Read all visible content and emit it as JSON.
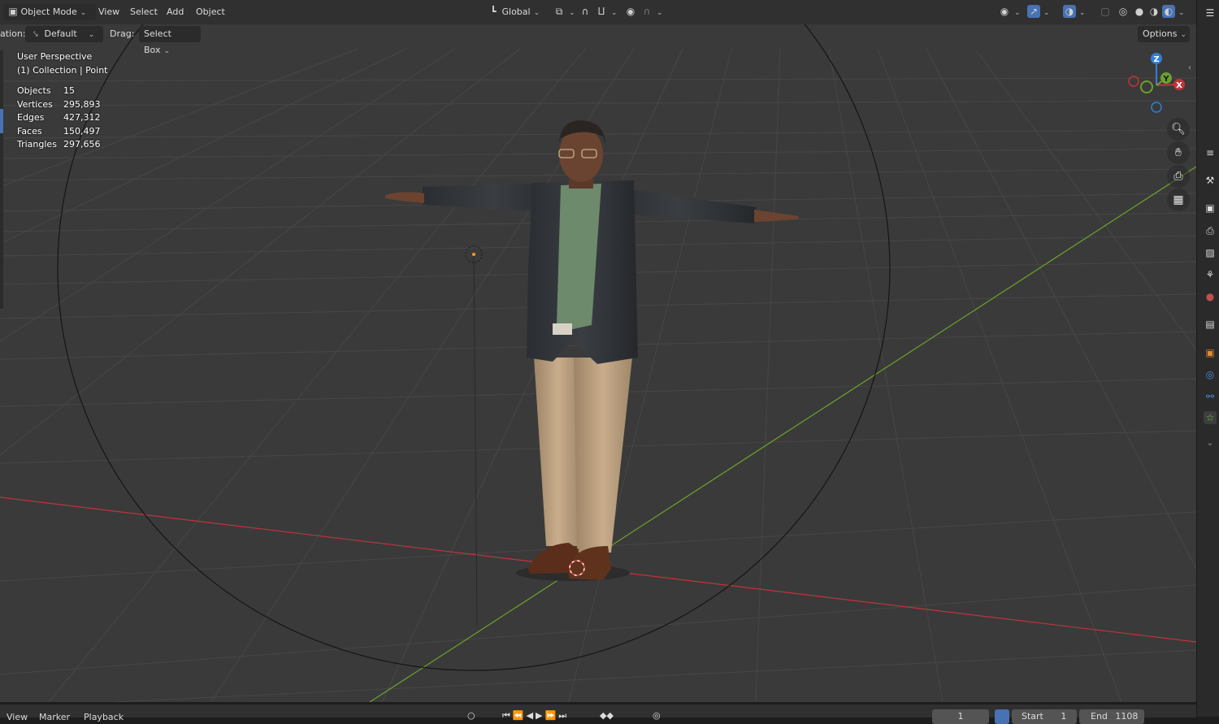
{
  "header": {
    "mode": "Object Mode",
    "menus": [
      "View",
      "Select",
      "Add",
      "Object"
    ],
    "transform_orientation": "Global"
  },
  "toolrow": {
    "orientation_label": "ation:",
    "orientation_value": "Default",
    "drag_label": "Drag:",
    "drag_value": "Select Box",
    "options_label": "Options"
  },
  "viewport": {
    "view_name": "User Perspective",
    "collection": "(1) Collection | Point",
    "stats": [
      {
        "label": "Objects",
        "value": "15"
      },
      {
        "label": "Vertices",
        "value": "295,893"
      },
      {
        "label": "Edges",
        "value": "427,312"
      },
      {
        "label": "Faces",
        "value": "150,497"
      },
      {
        "label": "Triangles",
        "value": "297,656"
      }
    ],
    "gizmo": {
      "x": "X",
      "y": "Y",
      "z": "Z"
    }
  },
  "timeline": {
    "menus": [
      "View",
      "Marker",
      "Playback"
    ],
    "current_frame": "1",
    "start_label": "Start",
    "start_value": "1",
    "end_label": "End",
    "end_value": "1108"
  },
  "colors": {
    "viewport_bg": "#3a3a3a",
    "grid": "#474747",
    "x_axis": "#c0343c",
    "y_axis": "#6ea12c",
    "z_axis": "#2f7fdc",
    "header_bg": "#303030"
  }
}
